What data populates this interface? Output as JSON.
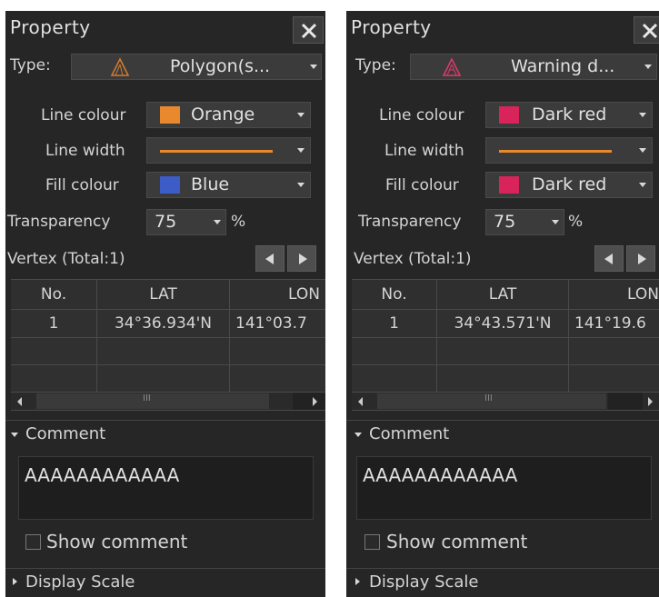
{
  "panels": [
    {
      "title": "Property",
      "type_label": "Type:",
      "type_value": "Polygon(s...",
      "type_icon_color": "#d07a30",
      "line_colour_label": "Line colour",
      "line_colour_value": "Orange",
      "line_colour_hex": "#e8892e",
      "line_width_label": "Line width",
      "line_sample_color": "#e8892e",
      "fill_colour_label": "Fill colour",
      "fill_colour_value": "Blue",
      "fill_colour_hex": "#3c5cc8",
      "transparency_label": "Transparency",
      "transparency_value": "75",
      "transparency_unit": "%",
      "vertex_label": "Vertex (Total:1)",
      "columns": [
        "No.",
        "LAT",
        "LON"
      ],
      "rows": [
        [
          "1",
          "34°36.934'N",
          "141°03.7"
        ]
      ],
      "scroll_mid": "III",
      "comment_label": "Comment",
      "comment_text": "AAAAAAAAAAAA",
      "show_comment_label": "Show comment",
      "display_scale_label": "Display Scale"
    },
    {
      "title": "Property",
      "type_label": "Type:",
      "type_value": "Warning d...",
      "type_icon_color": "#d83a6a",
      "line_colour_label": "Line colour",
      "line_colour_value": "Dark red",
      "line_colour_hex": "#d8245a",
      "line_width_label": "Line width",
      "line_sample_color": "#e8892e",
      "fill_colour_label": "Fill colour",
      "fill_colour_value": "Dark red",
      "fill_colour_hex": "#d8245a",
      "transparency_label": "Transparency",
      "transparency_value": "75",
      "transparency_unit": "%",
      "vertex_label": "Vertex (Total:1)",
      "columns": [
        "No.",
        "LAT",
        "LON"
      ],
      "rows": [
        [
          "1",
          "34°43.571'N",
          "141°19.6"
        ]
      ],
      "scroll_mid": "III",
      "comment_label": "Comment",
      "comment_text": "AAAAAAAAAAAA",
      "show_comment_label": "Show comment",
      "display_scale_label": "Display Scale"
    }
  ]
}
